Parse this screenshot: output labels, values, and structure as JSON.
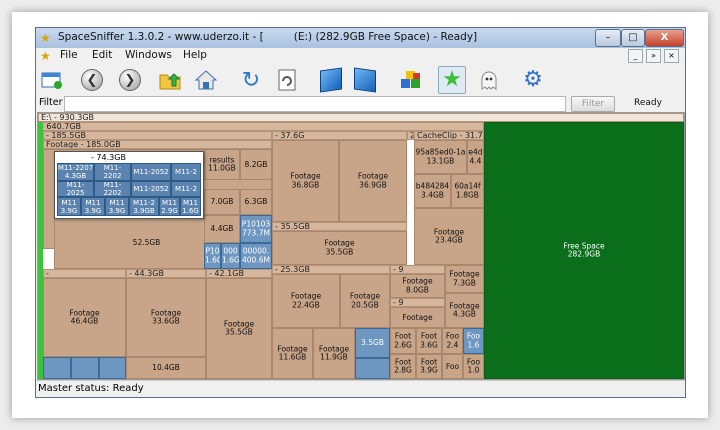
{
  "window": {
    "title": "SpaceSniffer 1.3.0.2 - www.uderzo.it - [         (E:) (282.9GB Free Space) - Ready]",
    "min_label": "–",
    "max_label": "□",
    "close_label": "X"
  },
  "menu": {
    "items": [
      "File",
      "Edit",
      "Windows",
      "Help"
    ],
    "mdi_min": "_",
    "mdi_restore": "»",
    "mdi_close": "×"
  },
  "toolbar": {
    "buttons": [
      "new-scan-icon",
      "back-icon",
      "forward-icon",
      "up-folder-icon",
      "home-icon",
      "refresh-icon",
      "rescan-icon",
      "cube-icon",
      "cube-alt-icon",
      "blocks-icon",
      "star-icon",
      "ghost-icon",
      "gear-icon"
    ],
    "back_glyph": "❮",
    "forward_glyph": "❯",
    "star_glyph": "★",
    "refresh_glyph": "↻",
    "gear_glyph": "⚙"
  },
  "filter": {
    "label": "Filter",
    "value": "",
    "button": "Filter",
    "status": "Ready"
  },
  "treemap": {
    "root": "E:\\ - 930.3GB",
    "top_header": "- 640.7GB",
    "blocks": {
      "h_185": "- 185.5GB",
      "footage_185": "Footage - 185.0GB",
      "tooltip": "- 74.3GB",
      "results": "results\n11.0GB",
      "b8_2": "8.2GB",
      "b7_0": "7.0GB",
      "b6_3": "6.3GB",
      "b4_4": "4.4GB",
      "p10103": "P10103\n773.7M",
      "p10_1": "P10\n1.6G",
      "b000": "000\n1.6G",
      "b00000": "00000.\n400.6M",
      "b52_5": "52.5GB",
      "h_37": "- 37.6G",
      "footage_36_8": "Footage\n36.8GB",
      "footage_36_9": "Footage\n36.9GB",
      "h_35_5": "- 35.5GB",
      "footage_35_5": "Footage\n35.5GB",
      "h_2": "2",
      "cacheclip": "CacheClip - 31.7G",
      "b95a": "95a85ed0-1a\n13.1GB",
      "e4d": "e4d\n4.4",
      "b484": "b484284\n3.4GB",
      "b60a": "60a14f\n1.8GB",
      "footage_23_4": "Footage\n23.4GB",
      "free": "Free Space\n282.9GB",
      "h_44": "- 44.3GB",
      "h_42": "- 42.1GB",
      "h_dash": "-",
      "footage_46_4": "Footage\n46.4GB",
      "footage_33_6": "Footage\n33.6GB",
      "b10_4": "10.4GB",
      "footage_35_5b": "Footage\n35.5GB",
      "h_25_3": "- 25.3GB",
      "footage_22_4": "Footage\n22.4GB",
      "footage_20_5": "Footage\n20.5GB",
      "footage_11_6": "Footage\n11.6GB",
      "footage_11_9": "Footage\n11.9GB",
      "b3_5": "3.5GB",
      "h_9a": "- 9",
      "footage_8_0": "Footage\n8.0GB",
      "h_9b": "- 9",
      "footage_plain": "Footage",
      "footage_7_3": "Footage\n7.3GB",
      "footage_4_3": "Footage\n4.3GB",
      "f2_6": "Foot\n2.6G",
      "f3_6": "Foot\n3.6G",
      "f2_4": "Foo\n2.4",
      "f1_6": "Foo\n1.6",
      "f2_8": "Foot\n2.8G",
      "f3_9": "Foot\n3.9G",
      "f_x": "Foo\n1.0",
      "f_y": "Foo"
    },
    "tooltip_cells": [
      [
        "M11-2207\n4.3GB",
        "M11-2202",
        "M11-2052",
        "M11-2"
      ],
      [
        "M11-2025",
        "M11-2202",
        "M11-2052",
        "M11-2"
      ],
      [
        "M11\n3.9G",
        "M11\n3.9G",
        "M11\n3.9G",
        "M11-2\n3.9GB",
        "M11\n2.9G",
        "M11\n1.6G"
      ]
    ]
  },
  "status": {
    "text": "Master status: Ready"
  }
}
